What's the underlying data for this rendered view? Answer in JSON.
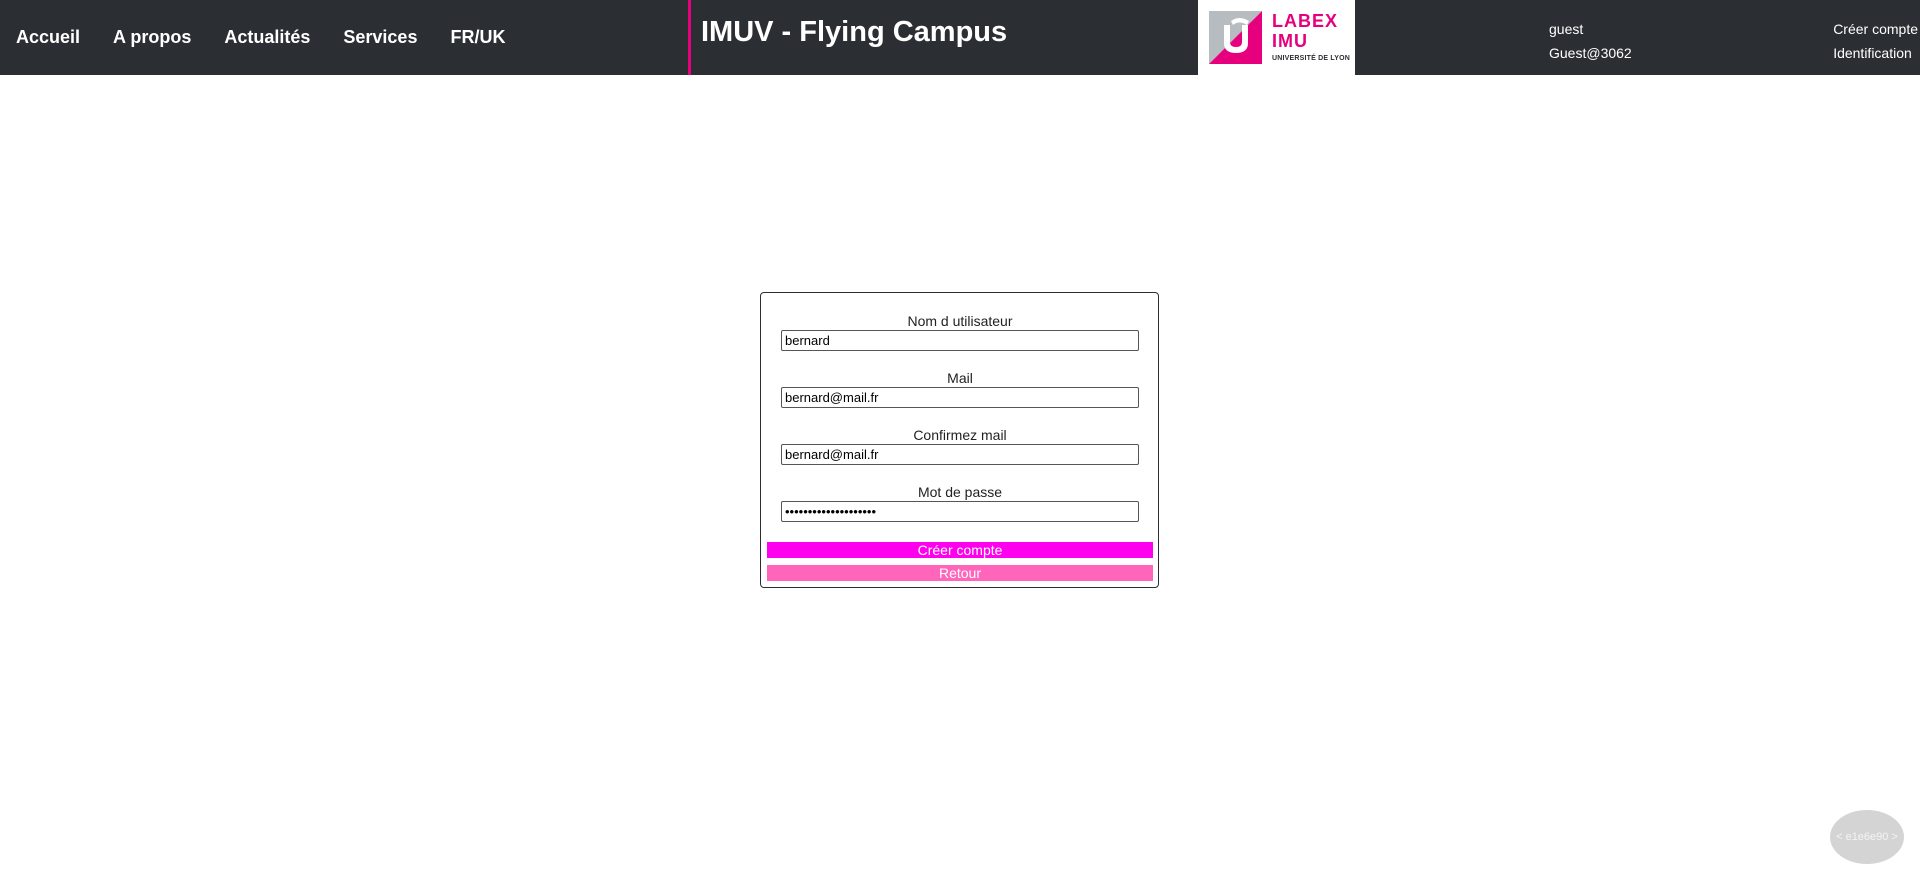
{
  "nav": {
    "items": [
      {
        "label": "Accueil"
      },
      {
        "label": "A propos"
      },
      {
        "label": "Actualités"
      },
      {
        "label": "Services"
      },
      {
        "label": "FR/UK"
      }
    ]
  },
  "header": {
    "title": "IMUV - Flying Campus",
    "accent_color": "#e6007e",
    "background_color": "#2b2e33"
  },
  "logo": {
    "line1": "LABEX",
    "line2": "IMU",
    "line3": "UNIVERSITÉ DE LYON"
  },
  "user": {
    "name": "guest",
    "id": "Guest@3062"
  },
  "account": {
    "create_label": "Créer compte",
    "login_label": "Identification"
  },
  "form": {
    "username_label": "Nom d utilisateur",
    "username_value": "bernard",
    "mail_label": "Mail",
    "mail_value": "bernard@mail.fr",
    "confirm_mail_label": "Confirmez mail",
    "confirm_mail_value": "bernard@mail.fr",
    "password_label": "Mot de passe",
    "password_value": "********************",
    "create_button": "Créer compte",
    "back_button": "Retour",
    "create_color": "#ff00ee",
    "back_color": "#ff66bb"
  },
  "version": {
    "label": "< e1e6e90 >"
  }
}
